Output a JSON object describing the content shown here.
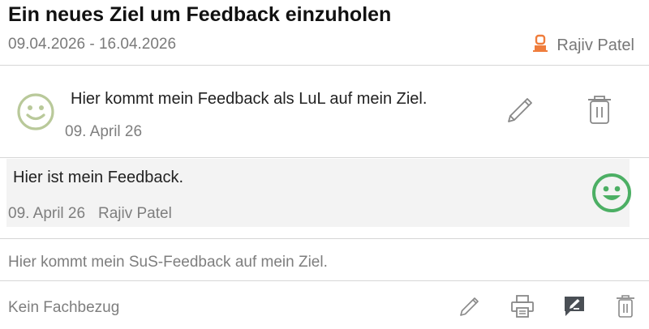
{
  "goal": {
    "title": "Ein neues Ziel um Feedback einzuholen",
    "date_range": "09.04.2026 - 16.04.2026",
    "owner_name": "Rajiv Patel",
    "owner_icon": "person-icon",
    "owner_icon_color": "#ef7d3c"
  },
  "teacher_feedback": {
    "mood_icon": "smiley-happy-icon",
    "mood_color": "#b9c99a",
    "text": "Hier kommt mein Feedback als LuL auf mein Ziel.",
    "date": "09. April 26",
    "actions": [
      "pencil-icon",
      "trash-icon"
    ]
  },
  "student_reply": {
    "text": "Hier ist mein Feedback.",
    "date": "09. April 26",
    "author": "Rajiv Patel",
    "mood_icon": "smiley-happy-icon",
    "mood_color": "#4caf64"
  },
  "student_feedback_prompt": "Hier kommt mein SuS-Feedback auf mein Ziel.",
  "footer": {
    "subject_text": "Kein Fachbezug",
    "actions": [
      "pencil-icon",
      "print-icon",
      "comment-edit-icon",
      "trash-icon"
    ]
  },
  "colors": {
    "divider": "#d6d6d6",
    "reply_background": "#f3f3f3",
    "icon_gray": "#888888"
  }
}
